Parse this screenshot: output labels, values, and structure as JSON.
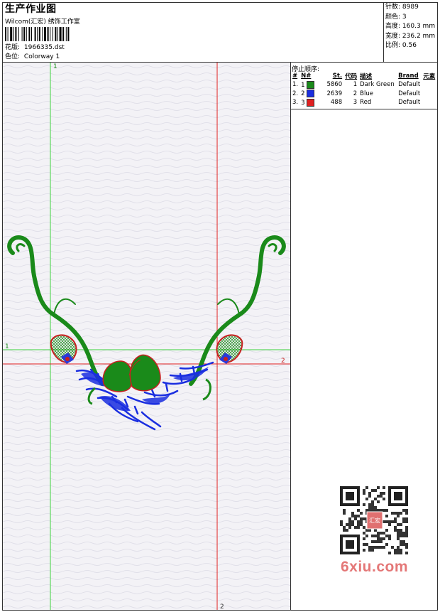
{
  "header": {
    "title": "生产作业图",
    "company": "Wilcom(汇宏) 绣饰工作室",
    "design_label": "花版:",
    "design_value": "1966335.dst",
    "colorway_label": "色位:",
    "colorway_value": "Colorway 1"
  },
  "stats": [
    {
      "label": "针数:",
      "value": "8989"
    },
    {
      "label": "颜色:",
      "value": "3"
    },
    {
      "label": "高度:",
      "value": "160.3 mm"
    },
    {
      "label": "宽度:",
      "value": "236.2 mm"
    },
    {
      "label": "比例:",
      "value": "0.56"
    }
  ],
  "stop_sequence": {
    "title": "停止顺序:",
    "headers": [
      "#",
      "N#",
      "St.",
      "代码",
      "描述",
      "Brand",
      "元素"
    ],
    "rows": [
      {
        "index": "1.",
        "n": "1",
        "color": "#1a8a1a",
        "stitches": "5860",
        "code": "1",
        "description": "Dark Green",
        "brand": "Default"
      },
      {
        "index": "2.",
        "n": "2",
        "color": "#1a2ee0",
        "stitches": "2639",
        "code": "2",
        "description": "Blue",
        "brand": "Default"
      },
      {
        "index": "3.",
        "n": "3",
        "color": "#e02020",
        "stitches": "488",
        "code": "3",
        "description": "Red",
        "brand": "Default"
      }
    ]
  },
  "guides": {
    "green_v_label": "1",
    "green_h_label": "1",
    "red_h_label": "2",
    "red_v_label": "2"
  },
  "watermark": {
    "badge": "汇宏",
    "text": "6xiu.com"
  }
}
